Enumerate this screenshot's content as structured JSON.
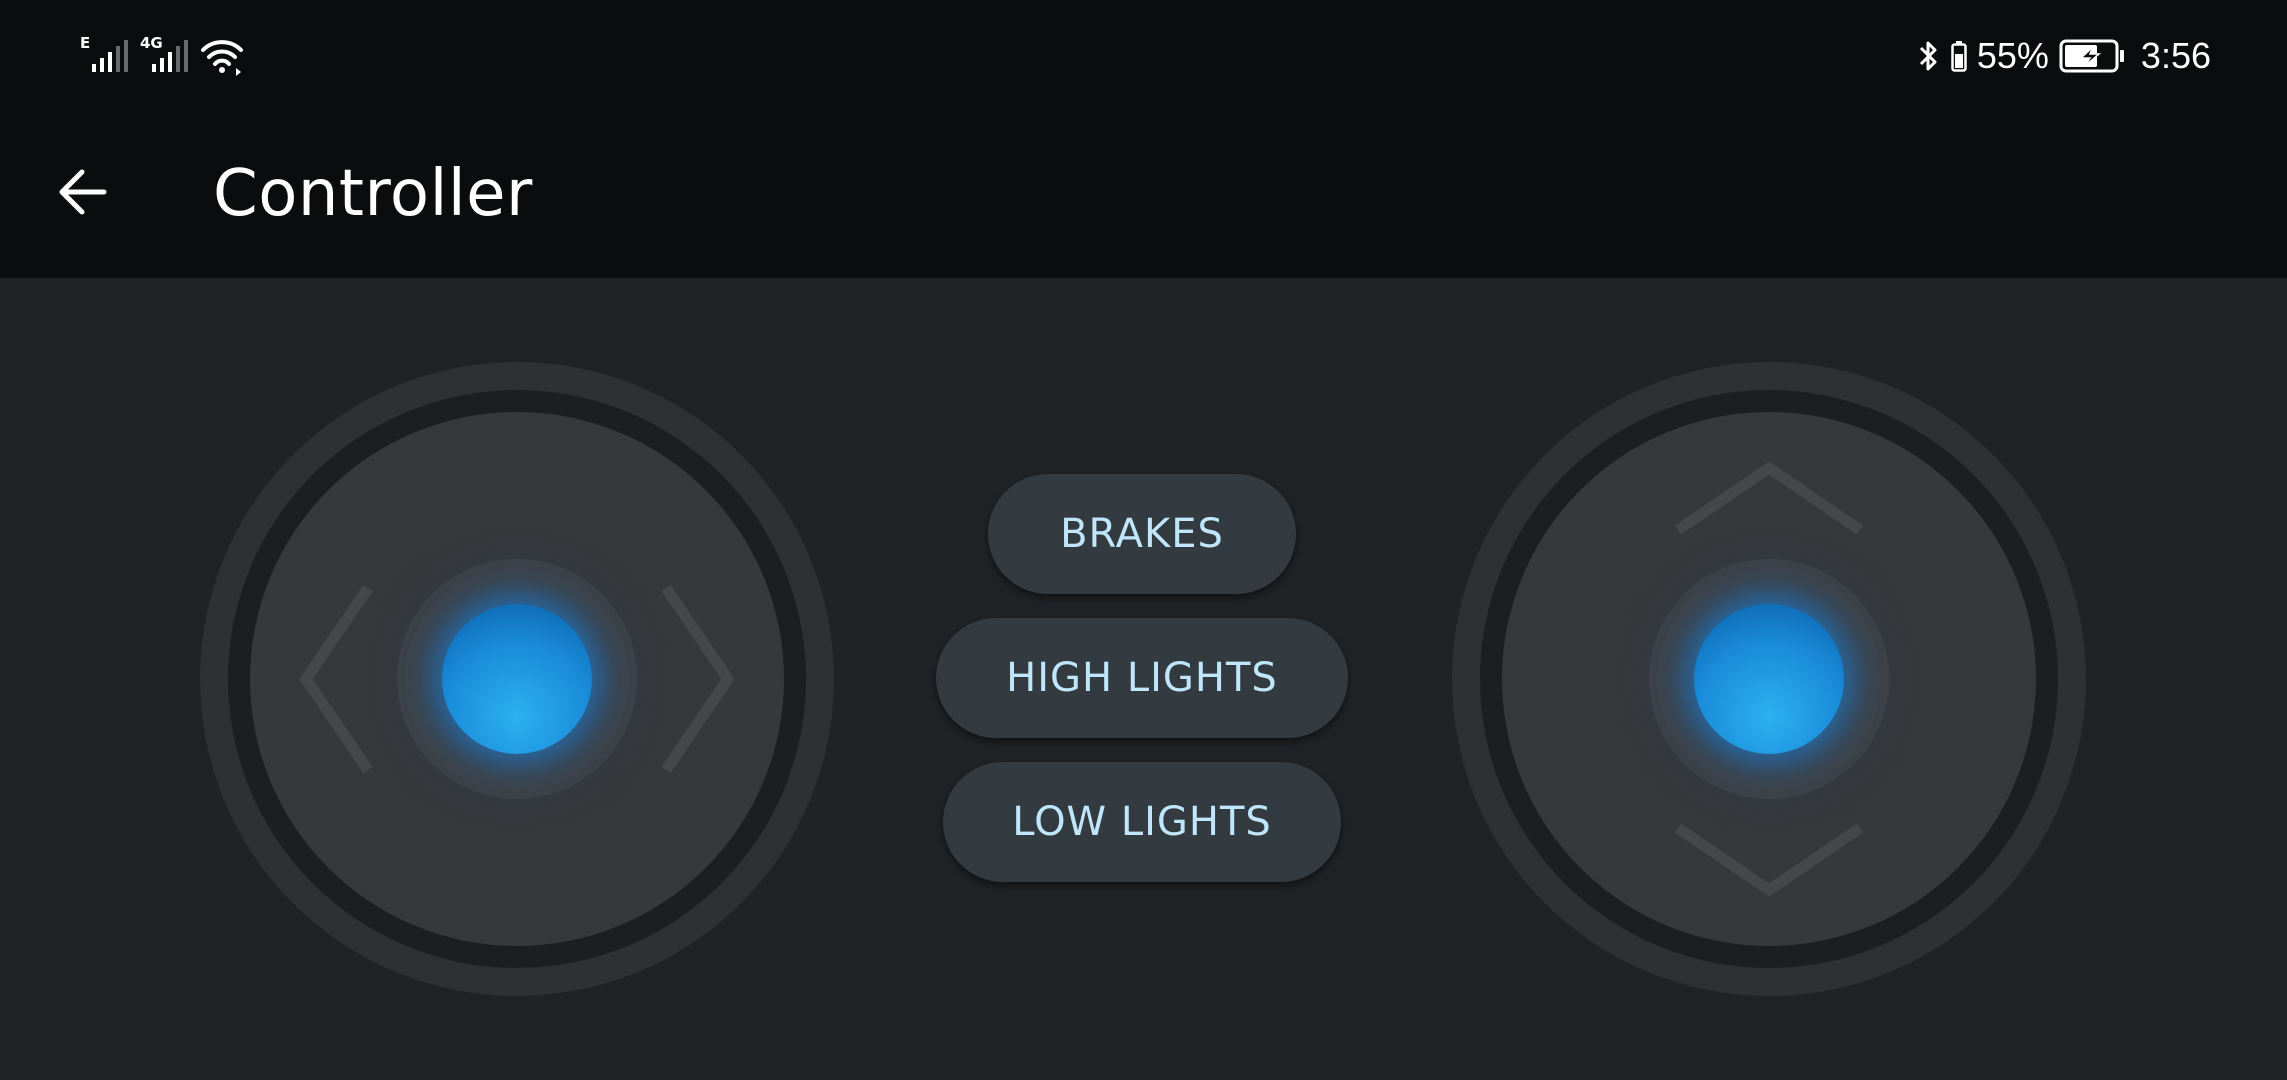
{
  "status_bar": {
    "signal_1_tag": "E",
    "signal_2_tag": "4G",
    "battery_percent": "55%",
    "time": "3:56",
    "icons": [
      "signal-e-icon",
      "signal-4g-icon",
      "wifi-icon",
      "bluetooth-icon",
      "battery-icon",
      "battery-charging-icon"
    ]
  },
  "app_bar": {
    "title": "Controller",
    "back_icon": "arrow-left-icon"
  },
  "controls": {
    "brakes_label": "BRAKES",
    "high_lights_label": "HIGH LIGHTS",
    "low_lights_label": "LOW LIGHTS"
  },
  "joysticks": {
    "left": {
      "axis": "horizontal",
      "icons": [
        "chevron-left-icon",
        "chevron-right-icon"
      ]
    },
    "right": {
      "axis": "vertical",
      "icons": [
        "chevron-up-icon",
        "chevron-down-icon"
      ]
    }
  },
  "colors": {
    "knob": "#1a8ad8",
    "button_text": "#bfe6fb",
    "button_bg": "#343b40",
    "background": "#1f2326",
    "bar_bg": "#0b0c0e"
  }
}
